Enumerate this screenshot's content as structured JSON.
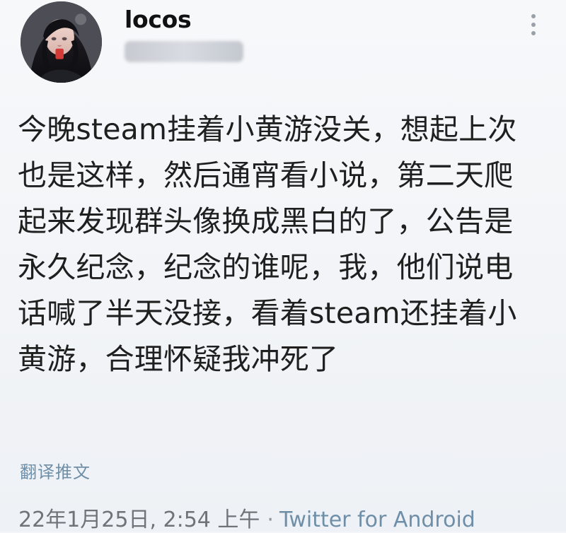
{
  "user": {
    "name": "locos",
    "handle_blurred": true
  },
  "tweet": {
    "text": "今晚steam挂着小黄游没关，想起上次也是这样，然后通宵看小说，第二天爬起来发现群头像换成黑白的了，公告是永久纪念，纪念的谁呢，我，他们说电话喊了半天没接，看着steam还挂着小黄游，合理怀疑我冲死了"
  },
  "actions": {
    "translate_label": "翻译推文"
  },
  "meta": {
    "date": "22年1月25日",
    "time": "2:54 上午",
    "separator": "·",
    "source": "Twitter for Android"
  },
  "icons": {
    "more": "more-vertical-icon"
  },
  "colors": {
    "background": "#f3f5f8",
    "text": "#1f1f1f",
    "link": "#6f8fa8",
    "meta": "#6f747b"
  }
}
